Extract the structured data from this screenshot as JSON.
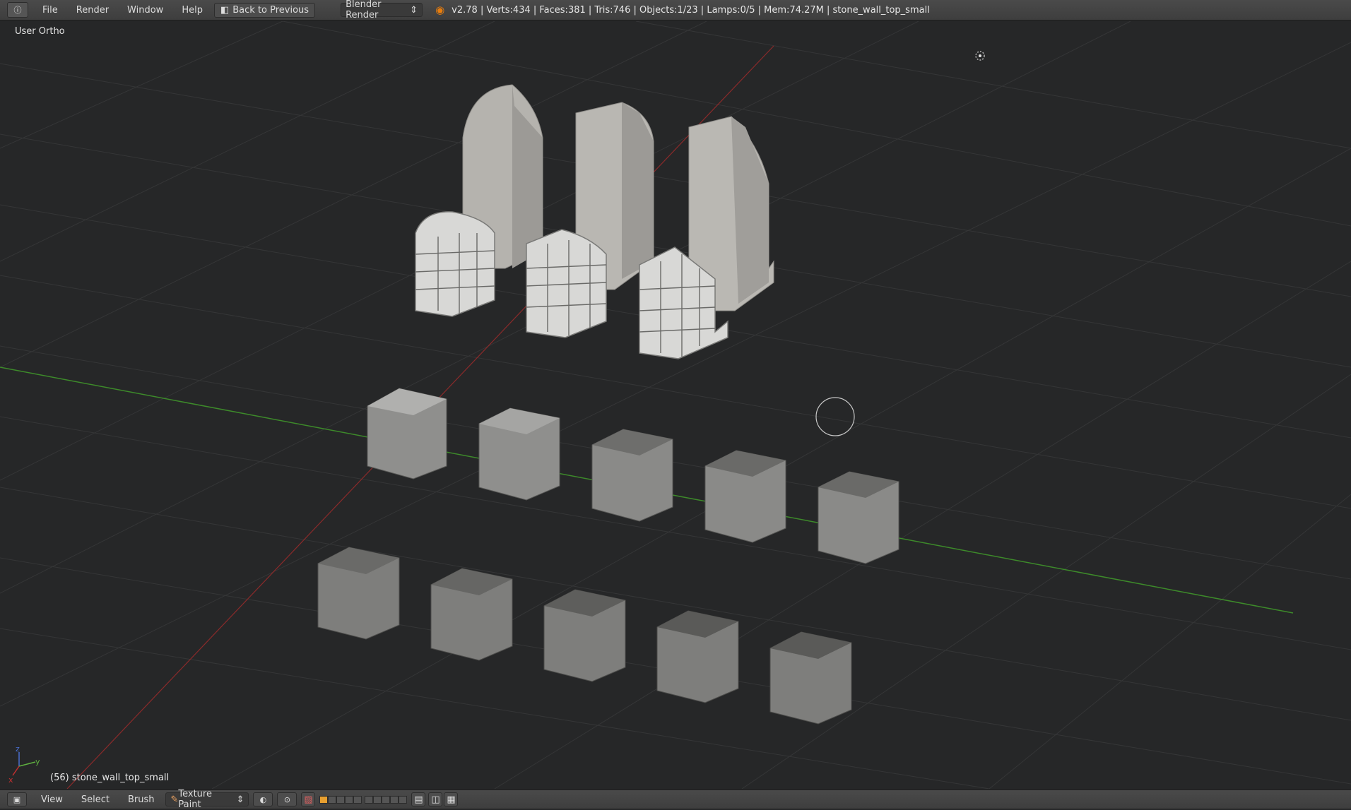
{
  "topbar": {
    "info_icon": "info-icon",
    "menus": [
      "File",
      "Render",
      "Window",
      "Help"
    ],
    "back_label": "Back to Previous",
    "render_engine": "Blender Render",
    "stats": "v2.78 | Verts:434 | Faces:381 | Tris:746 | Objects:1/23 | Lamps:0/5 | Mem:74.27M | stone_wall_top_small"
  },
  "viewport": {
    "view_label": "User Ortho",
    "object_label": "(56) stone_wall_top_small",
    "axis_x": "x",
    "axis_y": "y",
    "axis_z": "z"
  },
  "bottombar": {
    "menus": [
      "View",
      "Select",
      "Brush"
    ],
    "mode": "Texture Paint"
  },
  "colors": {
    "background": "#262728",
    "grid": "#353637",
    "x_axis": "#8a2a2a",
    "y_axis": "#3d8a2a",
    "accent": "#e87d0d"
  }
}
